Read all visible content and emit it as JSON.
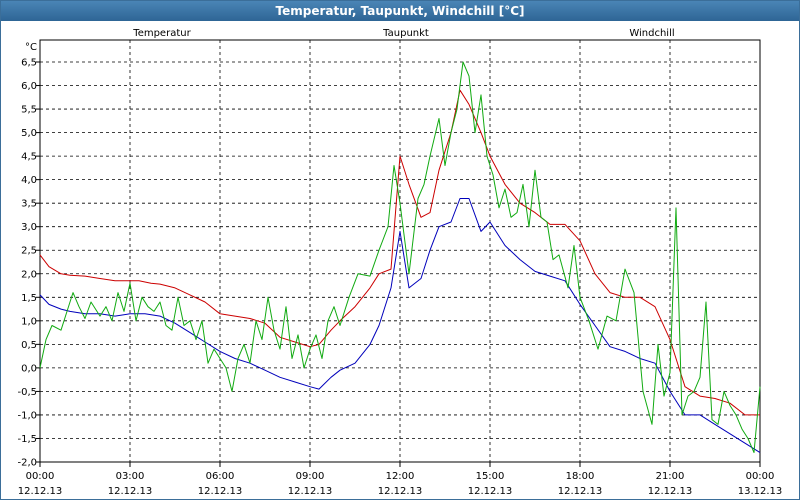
{
  "window": {
    "title": "Temperatur, Taupunkt, Windchill [°C]"
  },
  "chart_data": {
    "type": "line",
    "title": "Temperatur, Taupunkt, Windchill [°C]",
    "ylabel": "°C",
    "ylim": [
      -2.0,
      6.5
    ],
    "xlim": [
      0,
      24
    ],
    "grid": true,
    "y_ticks": [
      "-2,0",
      "-1,5",
      "-1,0",
      "-0,5",
      "0,0",
      "0,5",
      "1,0",
      "1,5",
      "2,0",
      "2,5",
      "3,0",
      "3,5",
      "4,0",
      "4,5",
      "5,0",
      "5,5",
      "6,0",
      "6,5"
    ],
    "x_ticks": [
      {
        "time": "00:00",
        "date": "12.12.13"
      },
      {
        "time": "03:00",
        "date": "12.12.13"
      },
      {
        "time": "06:00",
        "date": "12.12.13"
      },
      {
        "time": "09:00",
        "date": "12.12.13"
      },
      {
        "time": "12:00",
        "date": "12.12.13"
      },
      {
        "time": "15:00",
        "date": "12.12.13"
      },
      {
        "time": "18:00",
        "date": "12.12.13"
      },
      {
        "time": "21:00",
        "date": "12.12.13"
      },
      {
        "time": "00:00",
        "date": "13.12.13"
      }
    ],
    "series": [
      {
        "name": "Temperatur",
        "color": "#cc0000",
        "x": [
          0,
          0.3,
          0.7,
          1,
          1.5,
          2,
          2.5,
          3,
          3.3,
          3.7,
          4,
          4.5,
          5,
          5.5,
          6,
          6.5,
          7,
          7.5,
          8,
          8.5,
          9,
          9.3,
          9.7,
          10,
          10.5,
          11,
          11.3,
          11.7,
          12,
          12.3,
          12.7,
          13,
          13.3,
          13.7,
          14,
          14.3,
          14.7,
          15,
          15.5,
          16,
          16.5,
          17,
          17.5,
          18,
          18.5,
          19,
          19.5,
          20,
          20.5,
          21,
          21.5,
          22,
          22.5,
          23,
          23.5,
          24
        ],
        "values": [
          2.4,
          2.15,
          2.0,
          1.97,
          1.95,
          1.9,
          1.85,
          1.85,
          1.85,
          1.8,
          1.78,
          1.7,
          1.55,
          1.4,
          1.15,
          1.1,
          1.05,
          0.95,
          0.65,
          0.55,
          0.45,
          0.5,
          0.8,
          1.0,
          1.3,
          1.7,
          2.0,
          2.1,
          4.5,
          3.9,
          3.2,
          3.3,
          4.2,
          5.0,
          5.9,
          5.6,
          5.0,
          4.5,
          3.9,
          3.5,
          3.3,
          3.05,
          3.05,
          2.7,
          2.0,
          1.6,
          1.5,
          1.5,
          1.3,
          0.6,
          -0.4,
          -0.6,
          -0.65,
          -0.75,
          -1.0,
          -1.0
        ]
      },
      {
        "name": "Taupunkt",
        "color": "#0000bb",
        "x": [
          0,
          0.3,
          0.7,
          1,
          1.5,
          2,
          2.5,
          3,
          3.5,
          4,
          4.5,
          5,
          5.5,
          6,
          6.5,
          7,
          7.5,
          8,
          8.5,
          9,
          9.3,
          9.7,
          10,
          10.5,
          11,
          11.3,
          11.7,
          12,
          12.3,
          12.7,
          13,
          13.3,
          13.7,
          14,
          14.3,
          14.7,
          15,
          15.5,
          16,
          16.5,
          17,
          17.5,
          18,
          18.5,
          19,
          19.5,
          20,
          20.5,
          21,
          21.5,
          22,
          22.5,
          23,
          23.5,
          24
        ],
        "values": [
          1.55,
          1.35,
          1.25,
          1.2,
          1.15,
          1.15,
          1.1,
          1.15,
          1.15,
          1.1,
          0.95,
          0.75,
          0.55,
          0.35,
          0.2,
          0.1,
          -0.05,
          -0.2,
          -0.3,
          -0.4,
          -0.45,
          -0.2,
          -0.05,
          0.1,
          0.5,
          0.9,
          1.7,
          2.9,
          1.7,
          1.9,
          2.5,
          3.0,
          3.1,
          3.6,
          3.6,
          2.9,
          3.1,
          2.6,
          2.3,
          2.05,
          1.95,
          1.85,
          1.35,
          0.9,
          0.45,
          0.35,
          0.2,
          0.1,
          -0.5,
          -1.0,
          -1.0,
          -1.2,
          -1.4,
          -1.6,
          -1.8
        ]
      },
      {
        "name": "Windchill",
        "color": "#11aa11",
        "x": [
          0,
          0.2,
          0.4,
          0.7,
          0.9,
          1.1,
          1.3,
          1.5,
          1.7,
          2.0,
          2.2,
          2.4,
          2.6,
          2.8,
          3.0,
          3.2,
          3.4,
          3.6,
          3.8,
          4.0,
          4.2,
          4.4,
          4.6,
          4.8,
          5.0,
          5.2,
          5.4,
          5.6,
          5.8,
          6.0,
          6.2,
          6.4,
          6.6,
          6.8,
          7.0,
          7.2,
          7.4,
          7.6,
          7.8,
          8.0,
          8.2,
          8.4,
          8.6,
          8.8,
          9.0,
          9.2,
          9.4,
          9.6,
          9.8,
          10.0,
          10.3,
          10.6,
          11.0,
          11.3,
          11.6,
          11.8,
          12.0,
          12.3,
          12.6,
          12.8,
          13.0,
          13.3,
          13.5,
          13.7,
          13.9,
          14.1,
          14.3,
          14.5,
          14.7,
          14.9,
          15.1,
          15.3,
          15.5,
          15.7,
          15.9,
          16.1,
          16.3,
          16.5,
          16.7,
          16.9,
          17.1,
          17.3,
          17.6,
          17.8,
          18.0,
          18.3,
          18.6,
          18.9,
          19.2,
          19.5,
          19.8,
          20.1,
          20.4,
          20.6,
          20.8,
          21.0,
          21.2,
          21.4,
          21.6,
          21.8,
          22.0,
          22.2,
          22.4,
          22.6,
          22.8,
          23.0,
          23.2,
          23.4,
          23.6,
          23.8,
          24.0
        ],
        "values": [
          0.0,
          0.6,
          0.9,
          0.8,
          1.2,
          1.6,
          1.3,
          1.05,
          1.4,
          1.1,
          1.3,
          1.0,
          1.6,
          1.2,
          1.8,
          1.0,
          1.5,
          1.3,
          1.2,
          1.4,
          0.9,
          0.8,
          1.5,
          0.9,
          1.0,
          0.6,
          1.0,
          0.1,
          0.4,
          0.2,
          0.0,
          -0.5,
          0.2,
          0.5,
          0.1,
          1.0,
          0.6,
          1.5,
          0.8,
          0.4,
          1.3,
          0.2,
          0.7,
          0.0,
          0.4,
          0.7,
          0.2,
          1.0,
          1.3,
          0.9,
          1.5,
          2.0,
          1.95,
          2.5,
          3.0,
          4.3,
          3.5,
          2.0,
          3.6,
          3.9,
          4.5,
          5.3,
          4.3,
          5.0,
          5.5,
          6.5,
          6.2,
          5.0,
          5.8,
          4.5,
          4.1,
          3.4,
          3.8,
          3.2,
          3.3,
          3.9,
          3.0,
          4.2,
          3.2,
          3.1,
          2.3,
          2.4,
          1.7,
          2.6,
          1.5,
          1.0,
          0.4,
          1.1,
          1.0,
          2.1,
          1.6,
          -0.5,
          -1.2,
          0.5,
          -0.6,
          -0.1,
          3.4,
          -1.0,
          -0.6,
          -0.5,
          -0.2,
          1.4,
          -1.1,
          -1.2,
          -0.5,
          -0.8,
          -1.0,
          -1.3,
          -1.5,
          -1.8,
          -0.4
        ]
      }
    ]
  }
}
